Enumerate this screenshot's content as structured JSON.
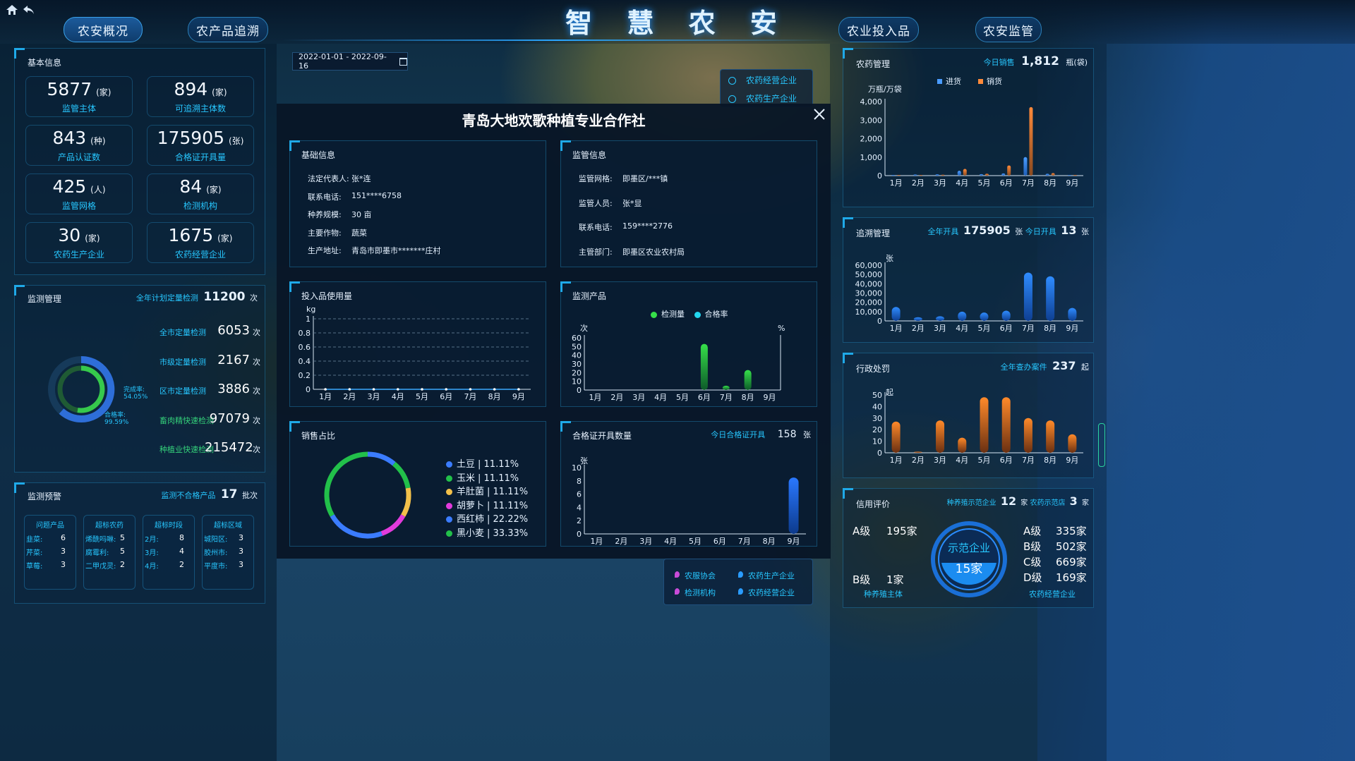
{
  "header": {
    "title": "智 慧 农 安",
    "nav_left": [
      "农安概况",
      "农产品追溯"
    ],
    "nav_right": [
      "农业投入品",
      "农安监管"
    ]
  },
  "date_range": "2022-01-01 - 2022-09-16",
  "map_legend_top": [
    "农药经营企业",
    "农药生产企业"
  ],
  "map_legend_bottom": [
    "农服协会",
    "农药生产企业",
    "检测机构",
    "农药经营企业"
  ],
  "left": {
    "basic": {
      "title": "基本信息",
      "stats": [
        {
          "value": "5877",
          "unit": "(家)",
          "label": "监管主体"
        },
        {
          "value": "894",
          "unit": "(家)",
          "label": "可追溯主体数"
        },
        {
          "value": "843",
          "unit": "(种)",
          "label": "产品认证数"
        },
        {
          "value": "175905",
          "unit": "(张)",
          "label": "合格证开具量"
        },
        {
          "value": "425",
          "unit": "(人)",
          "label": "监管网格"
        },
        {
          "value": "84",
          "unit": "(家)",
          "label": "检测机构"
        },
        {
          "value": "30",
          "unit": "(家)",
          "label": "农药生产企业"
        },
        {
          "value": "1675",
          "unit": "(家)",
          "label": "农药经营企业"
        }
      ]
    },
    "monitor": {
      "title": "监测管理",
      "summary_label": "全年计划定量检测",
      "summary_value": "11200",
      "summary_unit": "次",
      "rows": [
        {
          "label": "全市定量检测",
          "value": "6053",
          "unit": "次"
        },
        {
          "label": "市级定量检测",
          "value": "2167",
          "unit": "次"
        },
        {
          "label": "区市定量检测",
          "value": "3886",
          "unit": "次"
        },
        {
          "label": "畜肉精快速检测",
          "value": "97079",
          "unit": "次"
        },
        {
          "label": "种植业快速检测",
          "value": "215472",
          "unit": "次"
        }
      ],
      "completion_label": "完成率:",
      "completion_value": "54.05%",
      "pass_label": "合格率:",
      "pass_value": "99.59%",
      "completion_pct": 54.05,
      "pass_pct": 99.59
    },
    "warning": {
      "title": "监测预警",
      "summary_label": "监测不合格产品",
      "summary_value": "17",
      "summary_unit": "批次",
      "columns": [
        {
          "header": "问题产品",
          "items": [
            [
              "韭菜:",
              "6"
            ],
            [
              "芹菜:",
              "3"
            ],
            [
              "草莓:",
              "3"
            ]
          ]
        },
        {
          "header": "超标农药",
          "items": [
            [
              "烯酰吗啉:",
              "5"
            ],
            [
              "腐霉利:",
              "5"
            ],
            [
              "二甲戊灵:",
              "2"
            ]
          ]
        },
        {
          "header": "超标时段",
          "items": [
            [
              "2月:",
              "8"
            ],
            [
              "3月:",
              "4"
            ],
            [
              "4月:",
              "2"
            ]
          ]
        },
        {
          "header": "超标区域",
          "items": [
            [
              "城阳区:",
              "3"
            ],
            [
              "胶州市:",
              "3"
            ],
            [
              "平度市:",
              "3"
            ]
          ]
        }
      ]
    }
  },
  "modal": {
    "title": "青岛大地欢歌种植专业合作社",
    "basic": {
      "title": "基础信息",
      "items": [
        [
          "法定代表人:",
          "张*连"
        ],
        [
          "联系电话:",
          "151****6758"
        ],
        [
          "种养规模:",
          "30 亩"
        ],
        [
          "主要作物:",
          "蔬菜"
        ],
        [
          "生产地址:",
          "青岛市即墨市*******庄村"
        ]
      ]
    },
    "supervise": {
      "title": "监管信息",
      "items": [
        [
          "监管网格:",
          "即墨区/***镇"
        ],
        [
          "监管人员:",
          "张*显"
        ],
        [
          "联系电话:",
          "159****2776"
        ],
        [
          "主管部门:",
          "即墨区农业农村局"
        ]
      ]
    },
    "input_usage": {
      "title": "投入品使用量"
    },
    "monitor_products": {
      "title": "监测产品"
    },
    "sales": {
      "title": "销售占比"
    },
    "certificate": {
      "title": "合格证开具数量",
      "today_label": "今日合格证开具",
      "today_value": "158",
      "today_unit": "张"
    }
  },
  "right": {
    "pesticide": {
      "title": "农药管理",
      "today_label": "今日销售",
      "today_value": "1,812",
      "today_unit": "瓶(袋)"
    },
    "trace": {
      "title": "追溯管理",
      "year_label": "全年开具",
      "year_value": "175905",
      "year_unit": "张",
      "today_label": "今日开具",
      "today_value": "13",
      "today_unit": "张"
    },
    "penalty": {
      "title": "行政处罚",
      "label": "全年查办案件",
      "value": "237",
      "unit": "起"
    },
    "credit": {
      "title": "信用评价",
      "demo_label1": "种养殖示范企业",
      "demo_value1": "12",
      "demo_unit1": "家",
      "demo_label2": "农药示范店",
      "demo_value2": "3",
      "demo_unit2": "家",
      "left_grades": [
        [
          "A级",
          "195家"
        ],
        [
          "B级",
          "1家"
        ]
      ],
      "left_caption": "种养殖主体",
      "center_label": "示范企业",
      "center_value": "15家",
      "right_grades": [
        [
          "A级",
          "335家"
        ],
        [
          "B级",
          "502家"
        ],
        [
          "C级",
          "669家"
        ],
        [
          "D级",
          "169家"
        ]
      ],
      "right_caption": "农药经营企业"
    }
  },
  "chart_data": [
    {
      "id": "pesticide",
      "type": "bar",
      "ylabel": "万瓶/万袋",
      "categories": [
        "1月",
        "2月",
        "3月",
        "4月",
        "5月",
        "6月",
        "7月",
        "8月",
        "9月"
      ],
      "series": [
        {
          "name": "进货",
          "values": [
            20,
            60,
            70,
            260,
            80,
            120,
            1000,
            100,
            10
          ]
        },
        {
          "name": "销货",
          "values": [
            10,
            40,
            50,
            360,
            100,
            550,
            3700,
            140,
            40
          ]
        }
      ],
      "ylim": [
        0,
        4000
      ],
      "yticks": [
        "0",
        "1,000",
        "2,000",
        "3,000",
        "4,000"
      ],
      "legend": "top"
    },
    {
      "id": "trace",
      "type": "bar",
      "ylabel": "张",
      "categories": [
        "1月",
        "2月",
        "3月",
        "4月",
        "5月",
        "6月",
        "7月",
        "8月",
        "9月"
      ],
      "values": [
        15000,
        4000,
        5000,
        10000,
        9000,
        11000,
        52000,
        48000,
        14000
      ],
      "ylim": [
        0,
        60000
      ],
      "yticks": [
        "0",
        "10,000",
        "20,000",
        "30,000",
        "40,000",
        "50,000",
        "60,000"
      ]
    },
    {
      "id": "penalty",
      "type": "bar",
      "ylabel": "起",
      "categories": [
        "1月",
        "2月",
        "3月",
        "4月",
        "5月",
        "6月",
        "7月",
        "8月",
        "9月"
      ],
      "values": [
        27,
        1,
        28,
        13,
        48,
        48,
        30,
        28,
        16
      ],
      "ylim": [
        0,
        50
      ],
      "yticks": [
        "0",
        "10",
        "20",
        "30",
        "40",
        "50"
      ]
    },
    {
      "id": "input_usage",
      "type": "line",
      "ylabel": "kg",
      "categories": [
        "1月",
        "2月",
        "3月",
        "4月",
        "5月",
        "6月",
        "7月",
        "8月",
        "9月"
      ],
      "values": [
        0,
        0,
        0,
        0,
        0,
        0,
        0,
        0,
        0
      ],
      "ylim": [
        0,
        1
      ],
      "yticks": [
        "0",
        "0.2",
        "0.4",
        "0.6",
        "0.8",
        "1"
      ]
    },
    {
      "id": "monitor_products",
      "type": "bar",
      "ylabel": "次",
      "y2label": "%",
      "categories": [
        "1月",
        "2月",
        "3月",
        "4月",
        "5月",
        "6月",
        "7月",
        "8月",
        "9月"
      ],
      "series": [
        {
          "name": "检测量",
          "values": [
            0,
            0,
            0,
            0,
            0,
            53,
            5,
            23,
            0
          ]
        },
        {
          "name": "合格率",
          "values": []
        }
      ],
      "ylim": [
        0,
        60
      ],
      "yticks": [
        "0",
        "10",
        "20",
        "30",
        "40",
        "50",
        "60"
      ]
    },
    {
      "id": "sales",
      "type": "pie",
      "labels": [
        "土豆",
        "玉米",
        "羊肚菌",
        "胡萝卜",
        "西红柿",
        "黑小麦"
      ],
      "values": [
        11.11,
        11.11,
        11.11,
        11.11,
        22.22,
        33.33
      ],
      "display": [
        "| 11.11%",
        "| 11.11%",
        "| 11.11%",
        "| 11.11%",
        "| 22.22%",
        "| 33.33%"
      ],
      "colors": [
        "#3b7cff",
        "#22c04a",
        "#f2c04a",
        "#e23bdc",
        "#3b7cff",
        "#22c04a"
      ]
    },
    {
      "id": "certificate",
      "type": "bar",
      "ylabel": "张",
      "categories": [
        "1月",
        "2月",
        "3月",
        "4月",
        "5月",
        "6月",
        "7月",
        "8月",
        "9月"
      ],
      "values": [
        0,
        0,
        0,
        0,
        0,
        0,
        0,
        0,
        8.5
      ],
      "ylim": [
        0,
        10
      ],
      "yticks": [
        "0",
        "2",
        "4",
        "6",
        "8",
        "10"
      ]
    }
  ]
}
